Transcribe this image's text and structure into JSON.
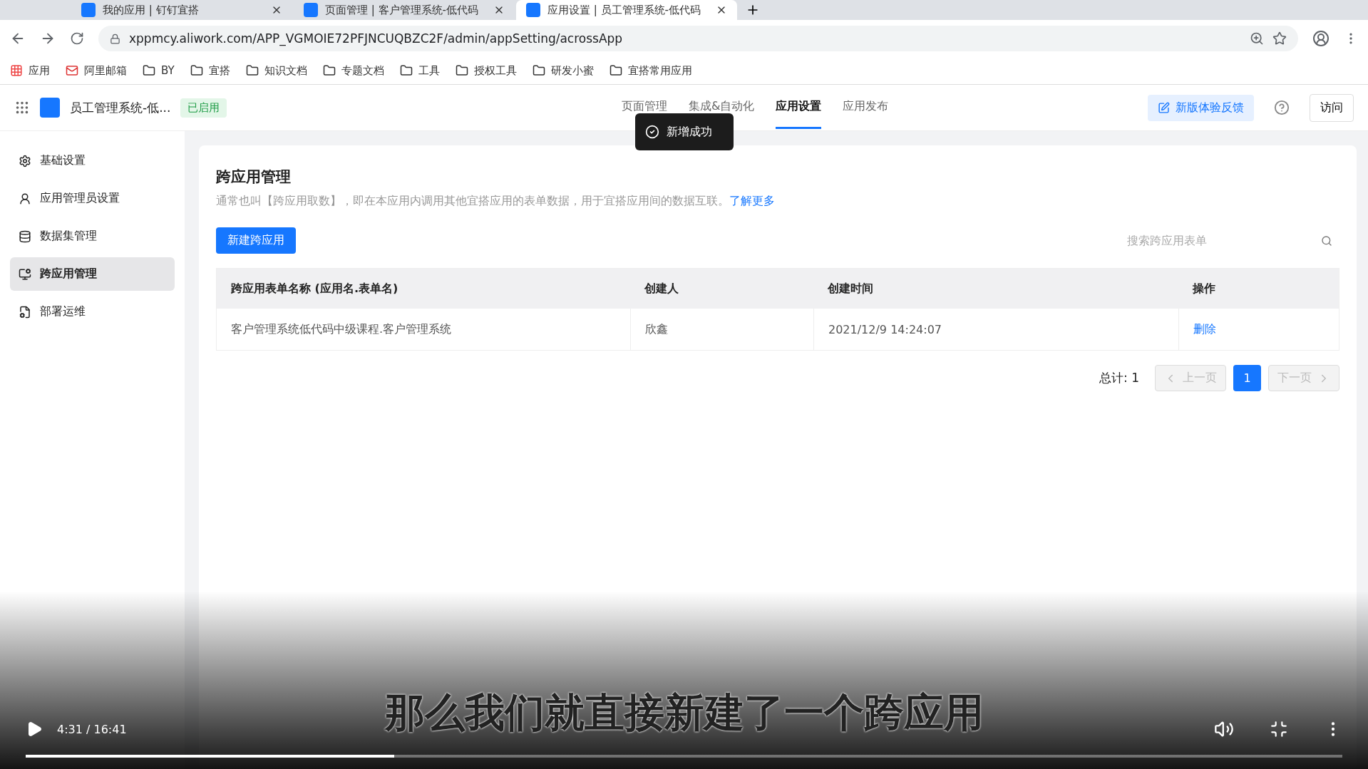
{
  "browser": {
    "tabs": [
      {
        "title": "我的应用 | 钉钉宜搭",
        "selected": false
      },
      {
        "title": "页面管理 | 客户管理系统-低代码",
        "selected": false
      },
      {
        "title": "应用设置 | 员工管理系统-低代码",
        "selected": true
      }
    ],
    "url": "xppmcy.aliwork.com/APP_VGMOIE72PFJNCUQBZC2F/admin/appSetting/acrossApp",
    "bookmarks": [
      {
        "label": "应用",
        "kind": "apps"
      },
      {
        "label": "阿里邮箱",
        "kind": "mail"
      },
      {
        "label": "BY",
        "kind": "folder"
      },
      {
        "label": "宜搭",
        "kind": "folder"
      },
      {
        "label": "知识文档",
        "kind": "folder"
      },
      {
        "label": "专题文档",
        "kind": "folder"
      },
      {
        "label": "工具",
        "kind": "folder"
      },
      {
        "label": "授权工具",
        "kind": "folder"
      },
      {
        "label": "研发小蜜",
        "kind": "folder"
      },
      {
        "label": "宜搭常用应用",
        "kind": "folder"
      }
    ]
  },
  "app_header": {
    "app_name": "员工管理系统-低...",
    "status": "已启用",
    "nav": [
      {
        "label": "页面管理",
        "selected": false
      },
      {
        "label": "集成&自动化",
        "selected": false
      },
      {
        "label": "应用设置",
        "selected": true
      },
      {
        "label": "应用发布",
        "selected": false
      }
    ],
    "feedback_button": "新版体验反馈",
    "visit_button": "访问"
  },
  "toast": "新增成功",
  "sidebar": {
    "items": [
      {
        "label": "基础设置",
        "selected": false
      },
      {
        "label": "应用管理员设置",
        "selected": false
      },
      {
        "label": "数据集管理",
        "selected": false
      },
      {
        "label": "跨应用管理",
        "selected": true
      },
      {
        "label": "部署运维",
        "selected": false
      }
    ]
  },
  "content": {
    "title": "跨应用管理",
    "description": "通常也叫【跨应用取数】，即在本应用内调用其他宜搭应用的表单数据，用于宜搭应用间的数据互联。",
    "link": "了解更多",
    "new_button": "新建跨应用",
    "search": {
      "placeholder": "搜索跨应用表单"
    },
    "table": {
      "columns": [
        "跨应用表单名称 (应用名.表单名)",
        "创建人",
        "创建时间",
        "操作"
      ],
      "rows": [
        {
          "name": "客户管理系统低代码中级课程.客户管理系统",
          "creator": "欣鑫",
          "created": "2021/12/9 14:24:07",
          "action": "删除"
        }
      ]
    },
    "pagination": {
      "total": "总计: 1",
      "prev": "上一页",
      "pages": [
        {
          "label": "1",
          "selected": true
        }
      ],
      "next": "下一页"
    }
  },
  "video": {
    "subtitle": "那么我们就直接新建了一个跨应用",
    "time": "4:31 / 16:41",
    "level": 0.28
  }
}
